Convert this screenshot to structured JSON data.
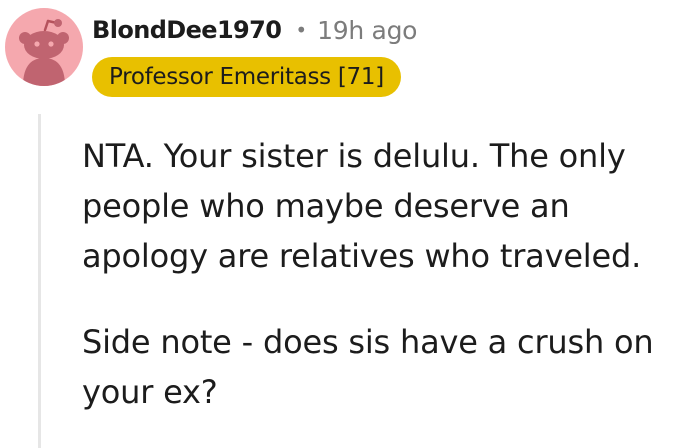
{
  "comment": {
    "author": "BlondDee1970",
    "separator": "•",
    "timestamp": "19h ago",
    "flair": "Professor Emeritass [71]",
    "avatar_icon": "reddit-snoo-avatar-icon",
    "colors": {
      "flair_background": "#e8c000",
      "avatar_background": "#f5a8ae",
      "meta_text": "#7c7c7c",
      "text": "#1c1c1c",
      "thread_line": "#e6e6e6"
    },
    "body": [
      "NTA. Your sister is delulu. The only people who maybe deserve an apology are relatives who traveled.",
      "Side note - does sis have a crush on your ex?"
    ]
  }
}
